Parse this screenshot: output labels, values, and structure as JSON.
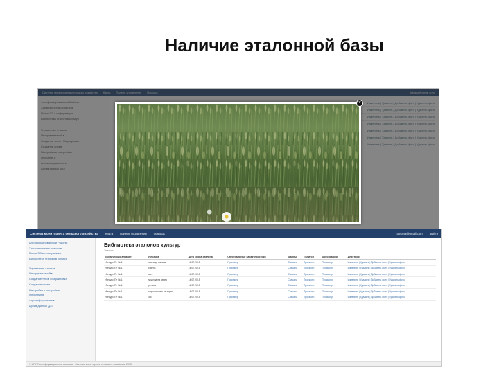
{
  "slide": {
    "title": "Наличие эталонной базы"
  },
  "background_window": {
    "nav_items": [
      "Система мониторинга сельского хозяйства",
      "Карта",
      "Панель управления",
      "Помощь"
    ],
    "nav_right": "tatyana@gmail.com"
  },
  "modal": {
    "close_symbol": "×"
  },
  "window": {
    "brand": "Система мониторинга сельского хозяйства",
    "nav": [
      "Карта",
      "Панель управления",
      "Помощь"
    ],
    "user": "tatyana@gmail.com",
    "exit": "Выйти",
    "sidebar": [
      "Агроформирования и Районы",
      "Характеристики участков",
      "Поиск ЭЭ и информации",
      "Библиотека эталонов культур",
      "",
      "Управление слоями",
      "Инструментарий ▸",
      "Создание тегов / Маркировка",
      "Создание слоев",
      "Настройка в настройках",
      "Описание ▸",
      "Агроинформатика ▸",
      "Архив данных ДЗЗ"
    ],
    "page_title": "Библиотека эталонов культур",
    "breadcrumb": "Эталоны",
    "columns": [
      "Космический аппарат",
      "Культура",
      "Дата сбора эталона",
      "Спектральные характеристики",
      "Файлы",
      "Полигон",
      "Фотографии",
      "Действия"
    ],
    "rows": [
      [
        "«Ресурс-П» № 1",
        "пшеница озимая",
        "14.07.2015",
        "Просмотр",
        "Скачать",
        "Просмотр",
        "Просмотр",
        "Изменить | Удалить | Добавить фото | Удалить фото"
      ],
      [
        "«Ресурс-П» № 1",
        "ячмень",
        "14.07.2015",
        "Просмотр",
        "Скачать",
        "Просмотр",
        "Просмотр",
        "Изменить | Удалить | Добавить фото | Удалить фото"
      ],
      [
        "«Ресурс-П» № 1",
        "овес",
        "14.07.2015",
        "Просмотр",
        "Скачать",
        "Просмотр",
        "Просмотр",
        "Изменить | Удалить | Добавить фото | Удалить фото"
      ],
      [
        "«Ресурс-П» № 1",
        "кукуруза на зерно",
        "14.07.2015",
        "Просмотр",
        "Скачать",
        "Просмотр",
        "Просмотр",
        "Изменить | Удалить | Добавить фото | Удалить фото"
      ],
      [
        "«Ресурс-П» № 1",
        "гречиха",
        "14.07.2015",
        "Просмотр",
        "Скачать",
        "Просмотр",
        "Просмотр",
        "Изменить | Удалить | Добавить фото | Удалить фото"
      ],
      [
        "«Ресурс-П» № 1",
        "подсолнечник на зерно",
        "14.07.2015",
        "Просмотр",
        "Скачать",
        "Просмотр",
        "Просмотр",
        "Изменить | Удалить | Добавить фото | Удалить фото"
      ],
      [
        "«Ресурс-П» № 1",
        "соя",
        "14.07.2015",
        "Просмотр",
        "Скачать",
        "Просмотр",
        "Просмотр",
        "Изменить | Удалить | Добавить фото | Удалить фото"
      ]
    ],
    "footer": "© ИПУ Геоинформационные системы · Система мониторинга сельского хозяйства, 2015"
  },
  "colors": {
    "navbar": "#23406a",
    "link": "#3b6fa8",
    "wheat_green": "#5f7a45"
  }
}
